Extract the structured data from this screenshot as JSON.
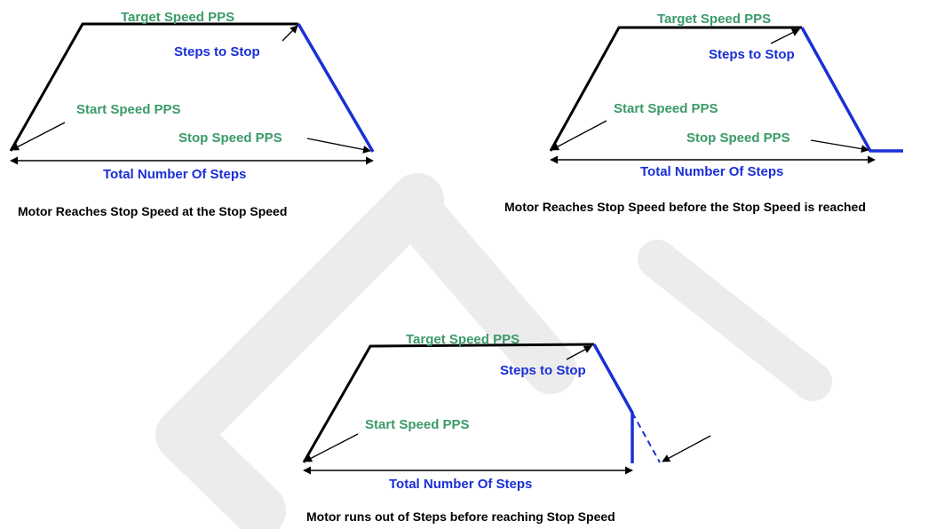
{
  "colors": {
    "label_green": "#3a9a68",
    "label_blue": "#1a2fd6",
    "line_black": "#000000",
    "line_blue": "#1a2fd6",
    "watermark": "#ececec",
    "caption": "#000000"
  },
  "diagrams": [
    {
      "target_speed_label": "Target Speed PPS",
      "steps_to_stop_label": "Steps to Stop",
      "start_speed_label": "Start Speed PPS",
      "stop_speed_label": "Stop Speed PPS",
      "total_steps_label": "Total Number Of Steps",
      "caption": "Motor Reaches Stop Speed at the Stop Speed"
    },
    {
      "target_speed_label": "Target Speed PPS",
      "steps_to_stop_label": "Steps to Stop",
      "start_speed_label": "Start Speed PPS",
      "stop_speed_label": "Stop Speed PPS",
      "total_steps_label": "Total Number Of Steps",
      "caption": "Motor Reaches Stop Speed before the Stop Speed is reached"
    },
    {
      "target_speed_label": "Target Speed PPS",
      "steps_to_stop_label": "Steps to Stop",
      "start_speed_label": "Start Speed PPS",
      "total_steps_label": "Total Number Of Steps",
      "caption": "Motor runs out of Steps before reaching Stop Speed"
    }
  ]
}
